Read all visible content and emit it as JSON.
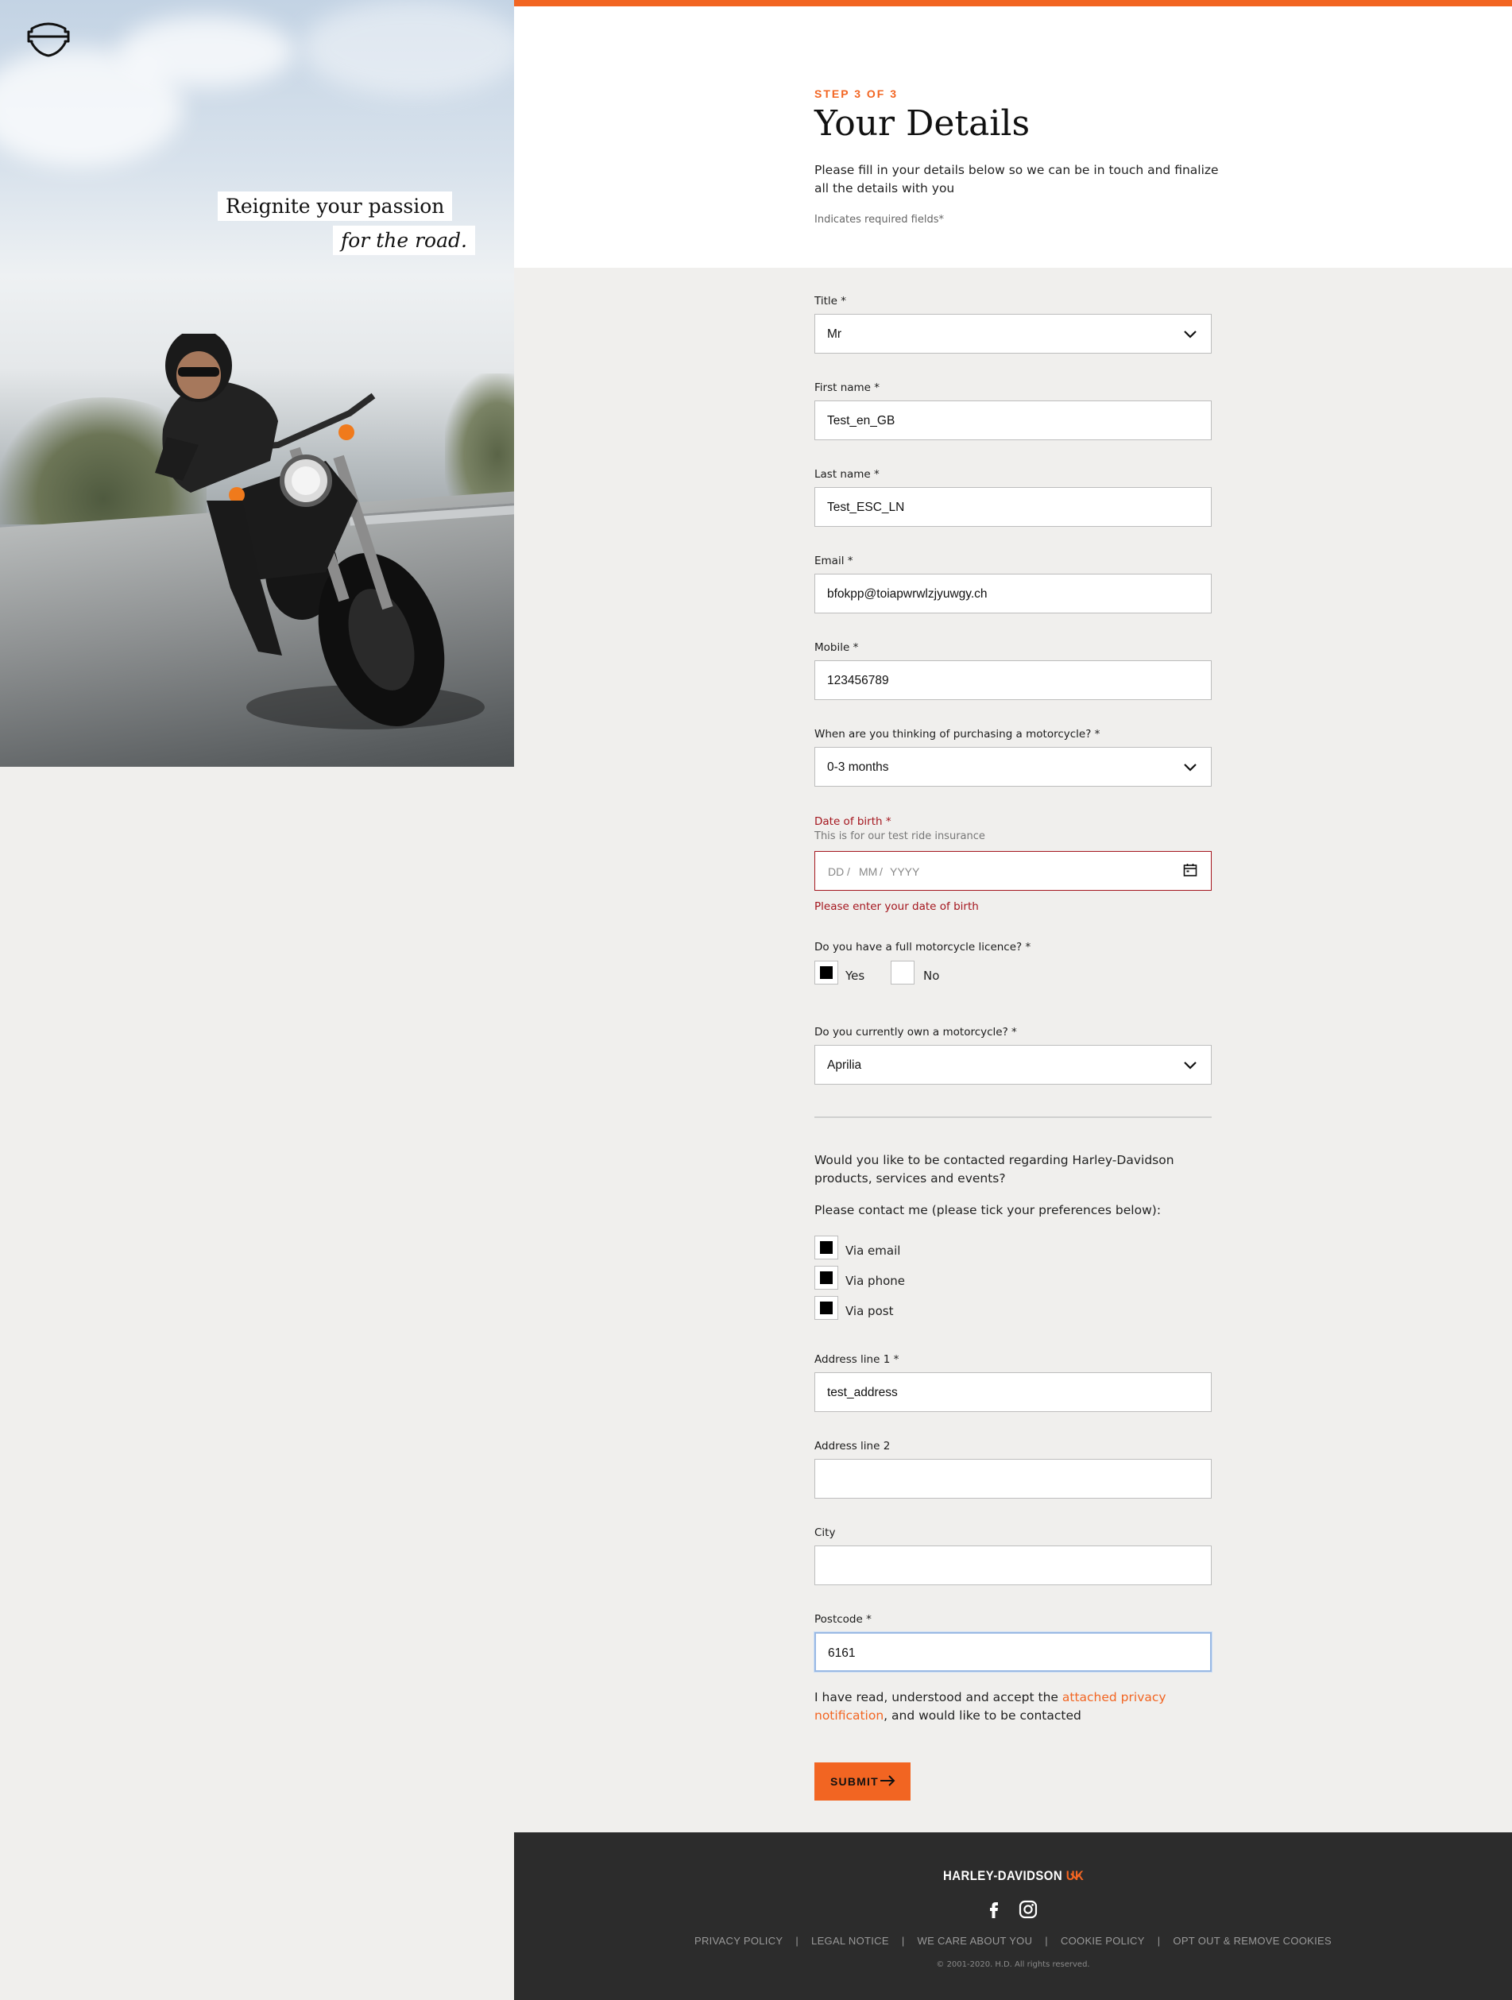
{
  "hero": {
    "tagline_line1": "Reignite your passion",
    "tagline_line2": "for the road.",
    "logo_icon": "bar-and-shield-icon"
  },
  "header": {
    "step": "STEP 3 OF 3",
    "title": "Your Details",
    "intro": "Please fill in your details below so we can be in touch and finalize all the details with you",
    "required_note": "Indicates required fields*"
  },
  "form": {
    "title": {
      "label": "Title *",
      "value": "Mr"
    },
    "first_name": {
      "label": "First name *",
      "value": "Test_en_GB"
    },
    "last_name": {
      "label": "Last name *",
      "value": "Test_ESC_LN"
    },
    "email": {
      "label": "Email *",
      "value": "bfokpp@toiapwrwlzjyuwgy.ch"
    },
    "mobile": {
      "label": "Mobile *",
      "value": "123456789"
    },
    "purchase_timing": {
      "label": "When are you thinking of purchasing a motorcycle? *",
      "value": "0-3 months"
    },
    "dob": {
      "label": "Date of birth *",
      "hint": "This is for our test ride insurance",
      "placeholder_dd": "DD",
      "placeholder_mm": "MM",
      "placeholder_yyyy": "YYYY",
      "sep": "/",
      "error": "Please enter your date of birth"
    },
    "licence": {
      "label": "Do you have a full motorcycle licence? *",
      "yes": "Yes",
      "no": "No",
      "yes_checked": true,
      "no_checked": false
    },
    "own_motorcycle": {
      "label": "Do you currently own a motorcycle? *",
      "value": "Aprilia"
    },
    "contact_question": "Would you like to be contacted regarding Harley-Davidson products, services and events?",
    "contact_prefs_intro": "Please contact me (please tick your preferences below):",
    "contact_prefs": [
      {
        "label": "Via email",
        "checked": true
      },
      {
        "label": "Via phone",
        "checked": true
      },
      {
        "label": "Via post",
        "checked": true
      }
    ],
    "address1": {
      "label": "Address line 1 *",
      "value": "test_address"
    },
    "address2": {
      "label": "Address line 2",
      "value": ""
    },
    "city": {
      "label": "City",
      "value": ""
    },
    "postcode": {
      "label": "Postcode *",
      "value": "6161"
    },
    "privacy_before": "I have read, understood and accept the ",
    "privacy_link": "attached privacy notification",
    "privacy_after": ", and would like to be contacted",
    "submit": "SUBMIT"
  },
  "footer": {
    "brand": "HARLEY-DAVIDSON",
    "region": "UK",
    "social": [
      "facebook-icon",
      "instagram-icon"
    ],
    "links": [
      "PRIVACY POLICY",
      "LEGAL NOTICE",
      "WE CARE ABOUT YOU",
      "COOKIE POLICY",
      "OPT OUT & REMOVE COOKIES"
    ],
    "copyright": "© 2001-2020. H.D. All rights reserved."
  },
  "colors": {
    "accent": "#f26522",
    "error": "#a4151d",
    "footer_bg": "#2c2c2c",
    "page_bg": "#f0efed"
  }
}
